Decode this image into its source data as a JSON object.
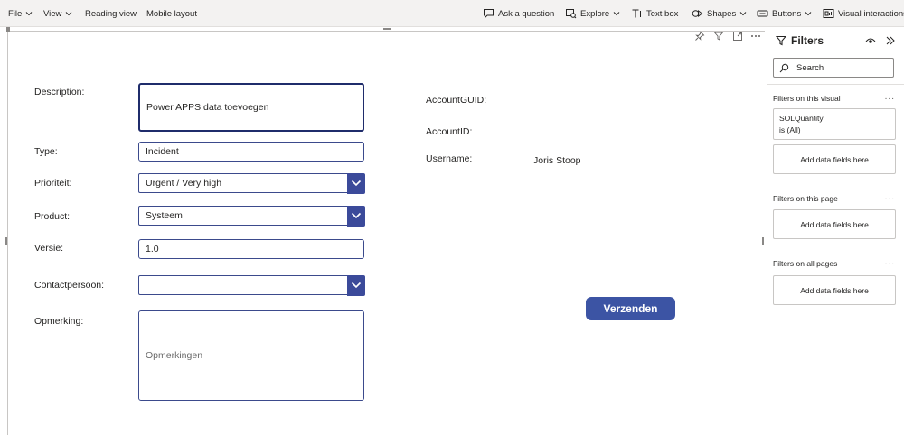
{
  "ribbon": {
    "file": "File",
    "view": "View",
    "reading_view": "Reading view",
    "mobile_layout": "Mobile layout",
    "ask_question": "Ask a question",
    "explore": "Explore",
    "text_box": "Text box",
    "shapes": "Shapes",
    "buttons": "Buttons",
    "visual_interactions": "Visual interactions"
  },
  "form": {
    "description": {
      "label": "Description:",
      "value": "Power APPS data toevoegen"
    },
    "type": {
      "label": "Type:",
      "value": "Incident"
    },
    "prioriteit": {
      "label": "Prioriteit:",
      "value": "Urgent / Very high"
    },
    "product": {
      "label": "Product:",
      "value": "Systeem"
    },
    "versie": {
      "label": "Versie:",
      "value": "1.0"
    },
    "contactpersoon": {
      "label": "Contactpersoon:",
      "value": ""
    },
    "opmerking": {
      "label": "Opmerking:",
      "placeholder": "Opmerkingen"
    },
    "account_guid": {
      "label": "AccountGUID:",
      "value": ""
    },
    "account_id": {
      "label": "AccountID:",
      "value": ""
    },
    "username": {
      "label": "Username:",
      "value": "Joris Stoop"
    },
    "submit_label": "Verzenden"
  },
  "filters": {
    "title": "Filters",
    "search_placeholder": "Search",
    "on_visual": {
      "heading": "Filters on this visual",
      "card_field": "SOLQuantity",
      "card_state": "is (All)",
      "drop": "Add data fields here"
    },
    "on_page": {
      "heading": "Filters on this page",
      "drop": "Add data fields here"
    },
    "on_all_pages": {
      "heading": "Filters on all pages",
      "drop": "Add data fields here"
    },
    "more": "..."
  },
  "colors": {
    "accent": "#3c54a4",
    "field_border": "#3b4a8c",
    "ribbon_bg": "#f3f2f1"
  }
}
